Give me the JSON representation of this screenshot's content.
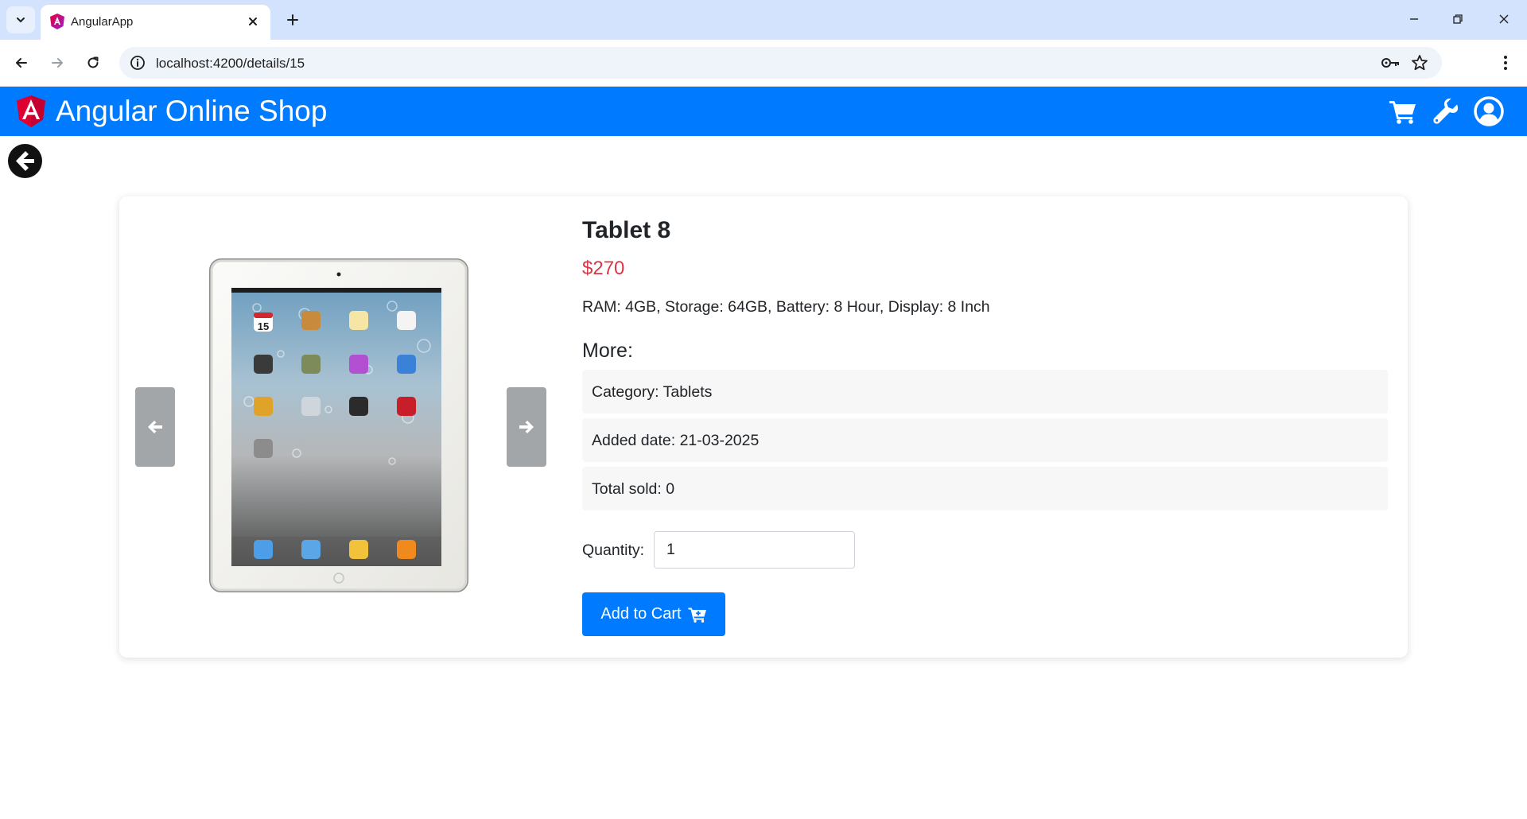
{
  "browser": {
    "tab_title": "AngularApp",
    "url": "localhost:4200/details/15"
  },
  "navbar": {
    "brand": "Angular Online Shop",
    "icons": [
      "cart-icon",
      "wrench-icon",
      "user-circle-icon"
    ]
  },
  "product": {
    "title": "Tablet 8",
    "price": "$270",
    "specs": "RAM: 4GB, Storage: 64GB, Battery: 8 Hour, Display: 8 Inch",
    "more_heading": "More:",
    "category": "Category: Tablets",
    "added_date": "Added date: 21-03-2025",
    "total_sold": "Total sold: 0",
    "tablet_screen_date": "15"
  },
  "purchase": {
    "quantity_label": "Quantity:",
    "quantity_value": "1",
    "add_to_cart_label": "Add to Cart"
  },
  "colors": {
    "primary": "#007bff",
    "price": "#dc3545",
    "angular_red": "#dd0031"
  }
}
